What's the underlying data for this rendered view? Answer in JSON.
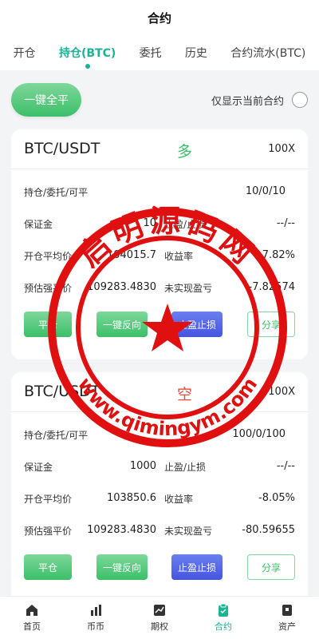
{
  "header": {
    "title": "合约"
  },
  "tabs": [
    {
      "label": "开仓",
      "active": false
    },
    {
      "label": "持仓(BTC)",
      "active": true
    },
    {
      "label": "委托",
      "active": false
    },
    {
      "label": "历史",
      "active": false
    },
    {
      "label": "合约流水(BTC)",
      "active": false
    }
  ],
  "toolbar": {
    "close_all_label": "一键全平",
    "only_current_label": "仅显示当前合约"
  },
  "positions": [
    {
      "symbol": "BTC/USDT",
      "side": "多",
      "leverage": "100X",
      "holding_label": "持仓/委托/可平",
      "holding_value": "10/0/10",
      "margin_label": "保证金",
      "margin_value": "10",
      "tpsl_label": "止盈/止损",
      "tpsl_value": "--/--",
      "avg_price_label": "开仓平均价",
      "avg_price_value": "104015.7",
      "yield_label": "收益率",
      "yield_value": "7.82%",
      "liq_label": "预估强平价",
      "liq_value": "109283.4830",
      "pnl_label": "未实现盈亏",
      "pnl_value": "-7.82574",
      "btn_close": "平仓",
      "btn_reverse": "一键反向",
      "btn_tpsl": "止盈止损",
      "btn_share": "分享"
    },
    {
      "symbol": "BTC/USDT",
      "side": "空",
      "leverage": "100X",
      "holding_label": "持仓/委托/可平",
      "holding_value": "100/0/100",
      "margin_label": "保证金",
      "margin_value": "1000",
      "tpsl_label": "止盈/止损",
      "tpsl_value": "--/--",
      "avg_price_label": "开仓平均价",
      "avg_price_value": "103850.6",
      "yield_label": "收益率",
      "yield_value": "-8.05%",
      "liq_label": "预估强平价",
      "liq_value": "109283.4830",
      "pnl_label": "未实现盈亏",
      "pnl_value": "-80.59655",
      "btn_close": "平仓",
      "btn_reverse": "一键反向",
      "btn_tpsl": "止盈止损",
      "btn_share": "分享"
    }
  ],
  "bottom_nav": [
    {
      "label": "首页",
      "icon": "home-icon",
      "active": false
    },
    {
      "label": "币币",
      "icon": "bar-chart-icon",
      "active": false
    },
    {
      "label": "期权",
      "icon": "trend-chart-icon",
      "active": false
    },
    {
      "label": "合约",
      "icon": "clipboard-icon",
      "active": true
    },
    {
      "label": "资产",
      "icon": "wallet-icon",
      "active": false
    }
  ],
  "watermark": {
    "brand": "启明源码网",
    "url": "www.qimingym.com",
    "color": "#e01010"
  },
  "colors": {
    "accent": "#1ab394",
    "long": "#3cbf69",
    "short": "#e74c3c",
    "blue": "#4455e0"
  }
}
